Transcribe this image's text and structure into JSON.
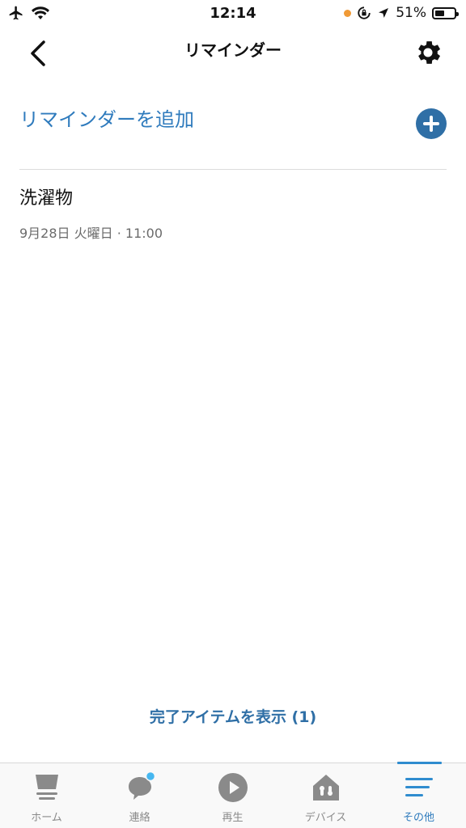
{
  "status_bar": {
    "time": "12:14",
    "battery": "51%",
    "battery_level": 0.51
  },
  "header": {
    "title": "リマインダー"
  },
  "add_reminder": {
    "label": "リマインダーを追加"
  },
  "reminders": [
    {
      "title": "洗濯物",
      "datetime": "9月28日 火曜日 · 11:00"
    }
  ],
  "completed_link": "完了アイテムを表示 (1)",
  "tabs": [
    {
      "label": "ホーム",
      "icon": "home-icon",
      "active": false
    },
    {
      "label": "連絡",
      "icon": "chat-bubble-icon",
      "active": false
    },
    {
      "label": "再生",
      "icon": "play-icon",
      "active": false
    },
    {
      "label": "デバイス",
      "icon": "devices-icon",
      "active": false
    },
    {
      "label": "その他",
      "icon": "menu-icon",
      "active": true
    }
  ],
  "colors": {
    "accent": "#2f7bbd",
    "add_button": "#2f6fa6",
    "notification_dot": "#46b7f0",
    "location_dot": "#f09a36"
  }
}
